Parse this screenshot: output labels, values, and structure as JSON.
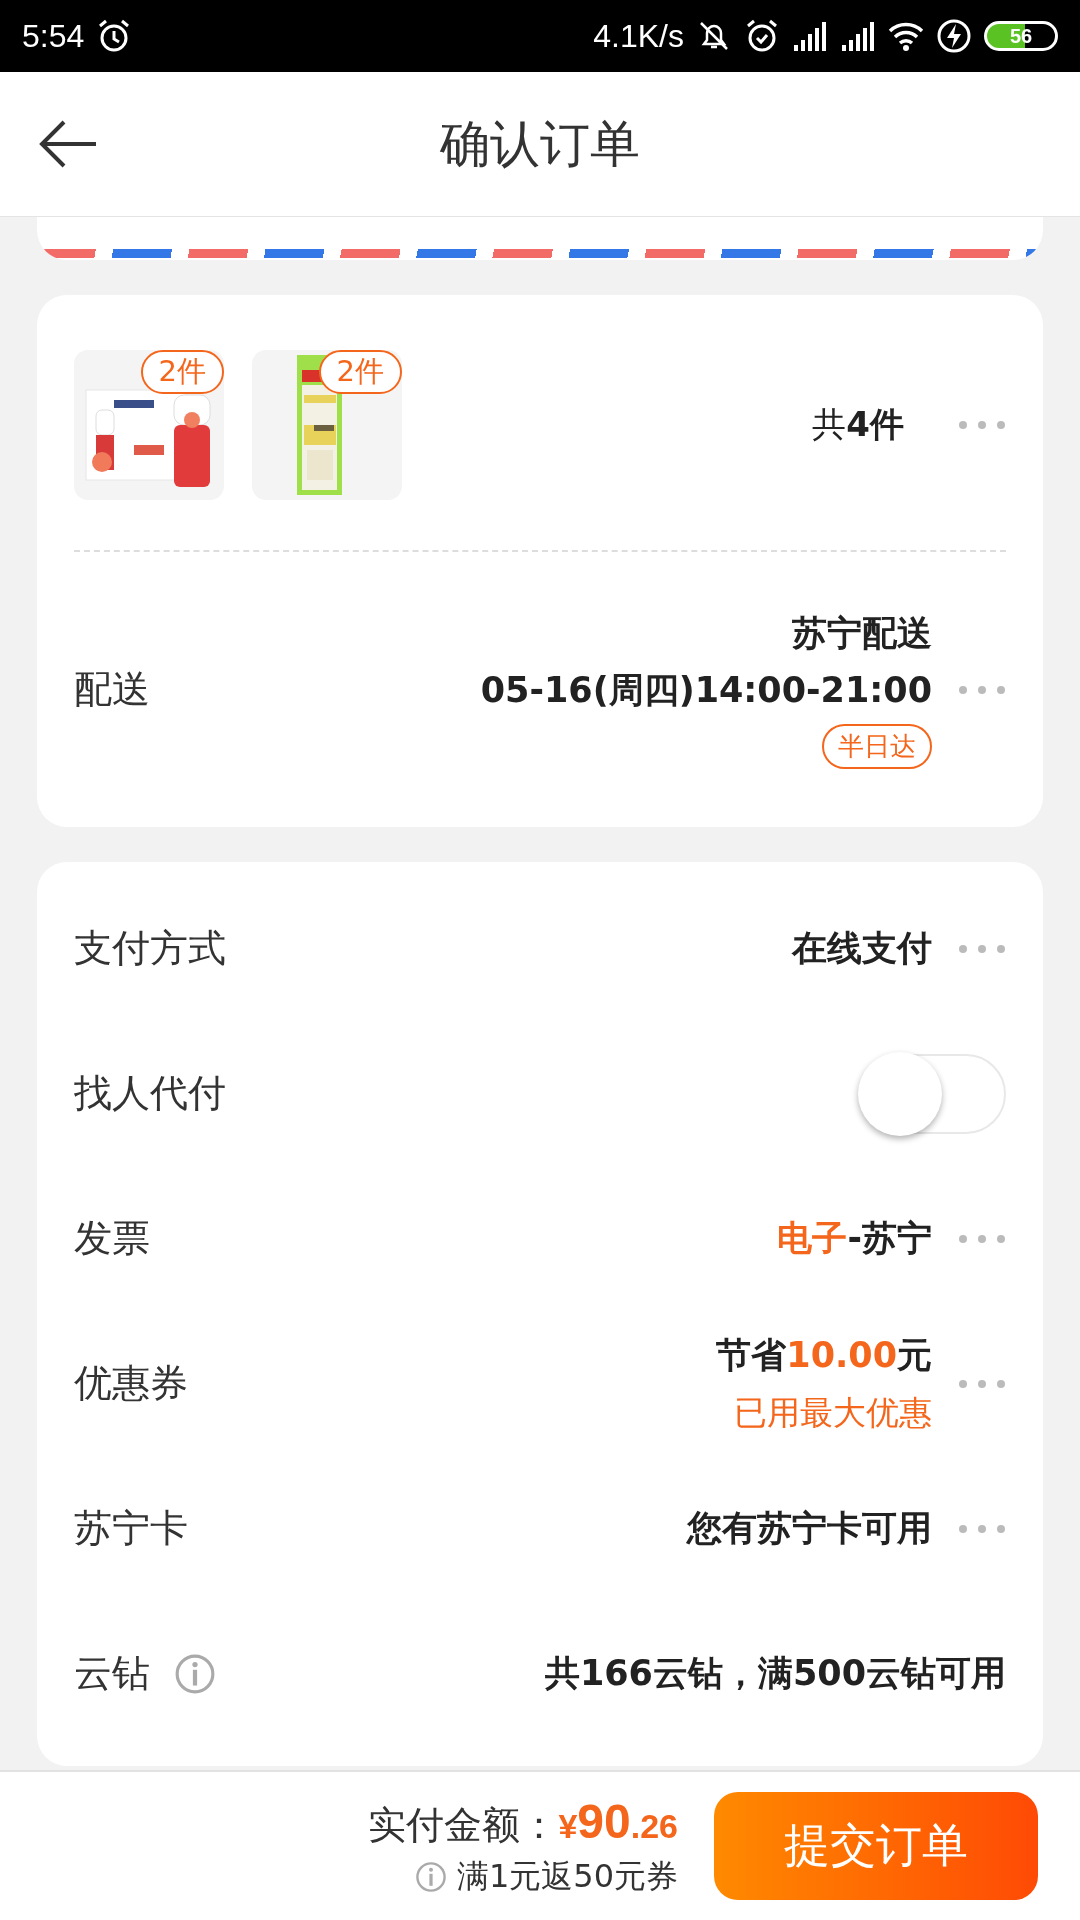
{
  "status_bar": {
    "time": "5:54",
    "network_speed": "4.1K/s",
    "battery": "56"
  },
  "header": {
    "title": "确认订单"
  },
  "products": {
    "items": [
      {
        "quantity": "2件",
        "kind": "picture"
      },
      {
        "quantity": "2件",
        "kind": "picture"
      }
    ],
    "total": "共**4件**"
  },
  "delivery": {
    "label": "配送",
    "carrier": "苏宁配送",
    "time": "05-16(周四)14:00-21:00",
    "badge": "半日达"
  },
  "options": [
    {
      "kind": "more",
      "label": "支付方式",
      "value": [
        {
          "text": "在线支付",
          "accent": false
        }
      ]
    },
    {
      "kind": "toggle",
      "label": "找人代付",
      "on": false
    },
    {
      "kind": "more",
      "label": "发票",
      "value": [
        {
          "text": "电子",
          "accent": true
        },
        {
          "text": "-苏宁",
          "accent": false
        }
      ]
    },
    {
      "kind": "more",
      "label": "优惠券",
      "value": [
        {
          "text": "节省",
          "accent": false
        },
        {
          "text": "10.00",
          "accent": true
        },
        {
          "text": "元",
          "accent": false
        }
      ],
      "note": "已用最大优惠"
    },
    {
      "kind": "more",
      "label": "苏宁卡",
      "value": [
        {
          "text": "您有苏宁卡可用",
          "accent": false
        }
      ]
    },
    {
      "kind": "info",
      "label": "云钻",
      "value": [
        {
          "text": "共166云钻，满500云钻可用",
          "accent": false
        }
      ]
    }
  ],
  "footer": {
    "total_label": "实付金额：",
    "price": {
      "currency": "¥",
      "integer": "90",
      "decimal": ".26"
    },
    "promo": "满1元返50元券",
    "submit": "提交订单"
  }
}
